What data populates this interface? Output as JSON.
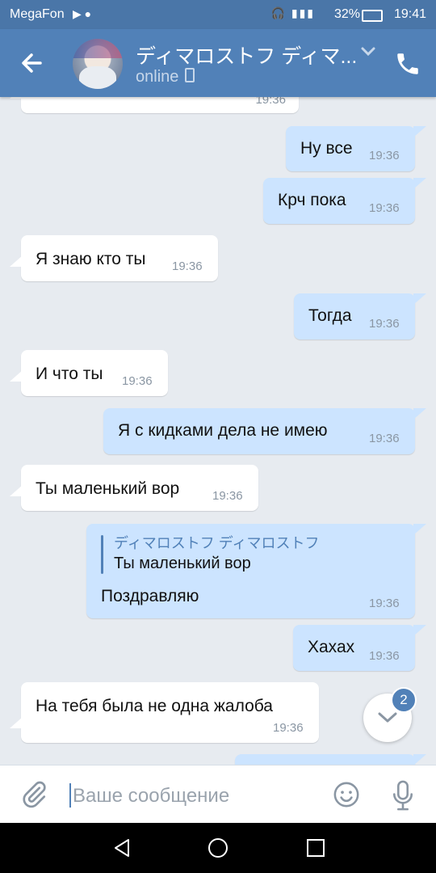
{
  "status_bar": {
    "carrier": "MegaFon",
    "battery": "32%",
    "time": "19:41"
  },
  "header": {
    "contact_name": "ディマロストフ ディマ...",
    "presence": "online",
    "colors": {
      "bar": "#5181b8",
      "status": "#4a76a8"
    }
  },
  "messages": [
    {
      "dir": "in",
      "text": "",
      "time": "19:36"
    },
    {
      "dir": "out",
      "text": "Ну все",
      "time": "19:36"
    },
    {
      "dir": "out",
      "text": "Крч пока",
      "time": "19:36"
    },
    {
      "dir": "in",
      "text": "Я знаю кто ты",
      "time": "19:36"
    },
    {
      "dir": "out",
      "text": "Тогда",
      "time": "19:36"
    },
    {
      "dir": "in",
      "text": "И что ты",
      "time": "19:36"
    },
    {
      "dir": "out",
      "text": "Я с кидками дела не имею",
      "time": "19:36"
    },
    {
      "dir": "in",
      "text": "Ты маленький вор",
      "time": "19:36"
    },
    {
      "dir": "out",
      "text": "Поздравляю",
      "time": "19:36",
      "reply": {
        "author": "ディマロストフ ディマロストフ",
        "text": "Ты маленький вор"
      }
    },
    {
      "dir": "out",
      "text": "Хахах",
      "time": "19:36"
    },
    {
      "dir": "in",
      "text": "На тебя была не одна жалоба",
      "time": "19:36"
    }
  ],
  "scroll_down": {
    "unread_count": "2"
  },
  "composer": {
    "placeholder": "Ваше сообщение"
  },
  "icons": {
    "back": "arrow-left-icon",
    "call": "phone-icon",
    "attach": "paperclip-icon",
    "emoji": "smiley-icon",
    "mic": "microphone-icon",
    "scroll": "chevron-down-icon"
  }
}
